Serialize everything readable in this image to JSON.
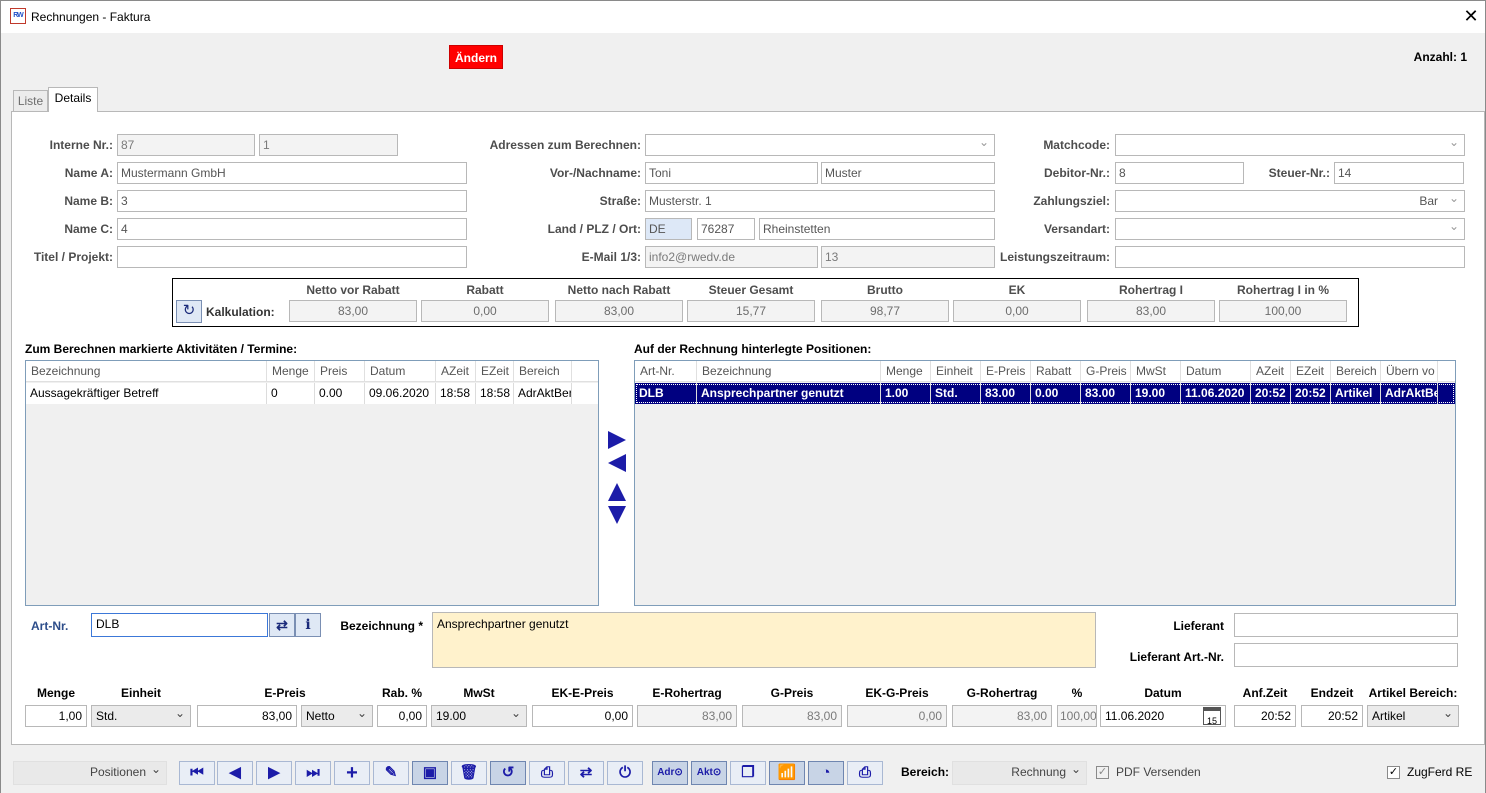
{
  "window": {
    "title": "Rechnungen - Faktura",
    "app_icon": "RW"
  },
  "toolbar": {
    "aendern_label": "Ändern",
    "anzahl": "Anzahl: 1"
  },
  "tabs": [
    {
      "label": "Liste"
    },
    {
      "label": "Details"
    }
  ],
  "form": {
    "interne_nr_label": "Interne Nr.:",
    "interne_nr": "87",
    "interne_nr2": "1",
    "name_a_label": "Name A:",
    "name_a": "Mustermann GmbH",
    "name_b_label": "Name B:",
    "name_b": "3",
    "name_c_label": "Name C:",
    "name_c": "4",
    "titel_label": "Titel / Projekt:",
    "titel": "",
    "adressen_label": "Adressen zum Berechnen:",
    "adressen": "",
    "vorname_label": "Vor-/Nachname:",
    "vorname": "Toni",
    "nachname": "Muster",
    "strasse_label": "Straße:",
    "strasse": "Musterstr. 1",
    "land_label": "Land / PLZ / Ort:",
    "land": "DE",
    "plz": "76287",
    "ort": "Rheinstetten",
    "email_label": "E-Mail 1/3:",
    "email": "info2@rwedv.de",
    "email3": "13",
    "matchcode_label": "Matchcode:",
    "matchcode": "",
    "debitor_label": "Debitor-Nr.:",
    "debitor": "8",
    "steuer_label": "Steuer-Nr.:",
    "steuer": "14",
    "zahlungsziel_label": "Zahlungsziel:",
    "zahlungsziel": "Bar",
    "versandart_label": "Versandart:",
    "versandart": "",
    "leistung_label": "Leistungszeitraum:",
    "leistung": ""
  },
  "kalkulation": {
    "label": "Kalkulation:",
    "headers": [
      "Netto vor Rabatt",
      "Rabatt",
      "Netto nach Rabatt",
      "Steuer Gesamt",
      "Brutto",
      "EK",
      "Rohertrag I",
      "Rohertrag I in %"
    ],
    "values": [
      "83,00",
      "0,00",
      "83,00",
      "15,77",
      "98,77",
      "0,00",
      "83,00",
      "100,00"
    ]
  },
  "left_grid": {
    "title": "Zum Berechnen markierte Aktivitäten / Termine:",
    "headers": [
      "Bezeichnung",
      "Menge",
      "Preis",
      "Datum",
      "AZeit",
      "EZeit",
      "Bereich"
    ],
    "rows": [
      [
        "Aussagekräftiger Betreff",
        "0",
        "0.00",
        "09.06.2020",
        "18:58",
        "18:58",
        "AdrAktBer"
      ]
    ]
  },
  "right_grid": {
    "title": "Auf der Rechnung hinterlegte Positionen:",
    "headers": [
      "Art-Nr.",
      "Bezeichnung",
      "Menge",
      "Einheit",
      "E-Preis",
      "Rabatt",
      "G-Preis",
      "MwSt",
      "Datum",
      "AZeit",
      "EZeit",
      "Bereich",
      "Übern vo"
    ],
    "rows": [
      [
        "DLB",
        "Ansprechpartner genutzt",
        "1.00",
        "Std.",
        "83.00",
        "0.00",
        "83.00",
        "19.00",
        "11.06.2020",
        "20:52",
        "20:52",
        "Artikel",
        "AdrAktBer"
      ]
    ]
  },
  "detail": {
    "artnr_label": "Art-Nr.",
    "artnr": "DLB",
    "bez_label": "Bezeichnung *",
    "bez": "Ansprechpartner genutzt",
    "lieferant_label": "Lieferant",
    "lieferant": "",
    "lieferant_art_label": "Lieferant Art.-Nr.",
    "lieferant_art": "",
    "info_icon": "i"
  },
  "bottom": {
    "labels": [
      "Menge",
      "Einheit",
      "E-Preis",
      "Rab. %",
      "MwSt",
      "EK-E-Preis",
      "E-Rohertrag",
      "G-Preis",
      "EK-G-Preis",
      "G-Rohertrag",
      "%",
      "Datum",
      "Anf.Zeit",
      "Endzeit",
      "Artikel Bereich:"
    ],
    "menge": "1,00",
    "einheit": "Std.",
    "epreis": "83,00",
    "netto": "Netto",
    "rab": "0,00",
    "mwst": "19.00",
    "ek_e_preis": "0,00",
    "e_rohertrag": "83,00",
    "g_preis": "83,00",
    "ek_g_preis": "0,00",
    "g_rohertrag": "83,00",
    "prozent": "100,00",
    "datum": "11.06.2020",
    "cal_day": "15",
    "anf_zeit": "20:52",
    "endzeit": "20:52",
    "artikel_bereich": "Artikel"
  },
  "footer": {
    "positionen": "Positionen",
    "bereich_label": "Bereich:",
    "bereich": "Rechnung",
    "pdf_label": "PDF Versenden",
    "zugferd_label": "ZugFerd RE",
    "adr_btn": "Adr⊙",
    "akt_btn": "Akt⊙"
  },
  "colors": {
    "selection": "#000080",
    "accent_red": "#ff0000",
    "icon_blue": "#1c1ca8",
    "highlight_yellow": "#fff2cc"
  }
}
